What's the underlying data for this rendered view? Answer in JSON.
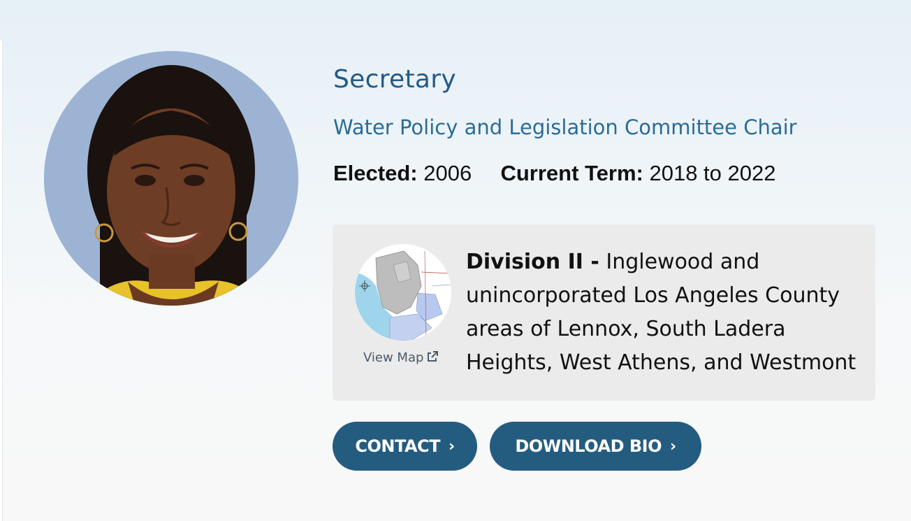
{
  "profile": {
    "title": "Secretary",
    "subtitle": "Water Policy and Legislation Committee Chair",
    "elected_label": "Elected:",
    "elected_value": "2006",
    "term_label": "Current Term:",
    "term_value": "2018 to 2022"
  },
  "division": {
    "name": "Division II -",
    "description": "Inglewood and unincorporated Los Angeles County areas of Lennox, South Ladera Heights, West Athens, and Westmont",
    "map_link": "View Map",
    "map_icon": "external-link-icon"
  },
  "buttons": {
    "contact": "CONTACT",
    "download_bio": "DOWNLOAD BIO",
    "chevron": "›"
  },
  "colors": {
    "primary": "#245c80",
    "title": "#235a86",
    "box_bg": "#ebebeb"
  }
}
